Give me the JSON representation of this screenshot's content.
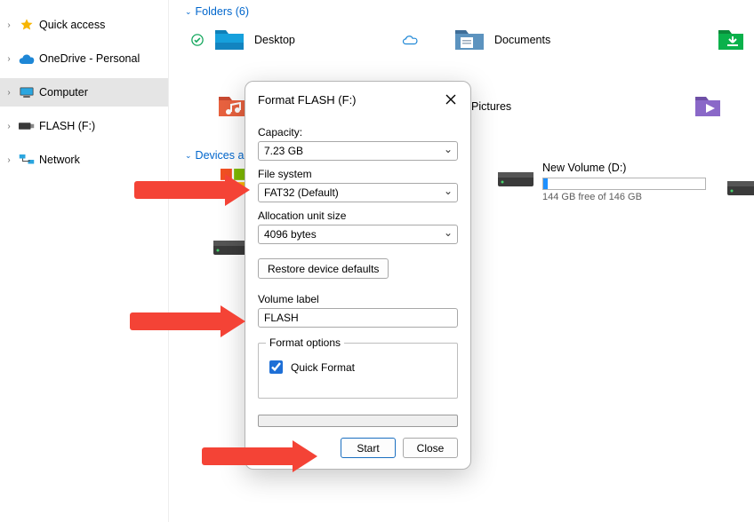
{
  "nav": {
    "items": [
      {
        "label": "Quick access"
      },
      {
        "label": "OneDrive - Personal"
      },
      {
        "label": "Computer"
      },
      {
        "label": "FLASH (F:)"
      },
      {
        "label": "Network"
      }
    ]
  },
  "groups": {
    "folders_header": "Folders (6)",
    "devices_header": "Devices a"
  },
  "folders": {
    "desktop": "Desktop",
    "documents": "Documents",
    "pictures": "Pictures"
  },
  "volume": {
    "label": "New Volume (D:)",
    "free_text": "144 GB free of 146 GB",
    "fill_pct": 3
  },
  "dialog": {
    "title": "Format FLASH (F:)",
    "capacity_label": "Capacity:",
    "capacity_value": "7.23 GB",
    "fs_label": "File system",
    "fs_value": "FAT32 (Default)",
    "alloc_label": "Allocation unit size",
    "alloc_value": "4096 bytes",
    "restore": "Restore device defaults",
    "volume_label_label": "Volume label",
    "volume_label_value": "FLASH",
    "format_options_legend": "Format options",
    "quick_format": "Quick Format",
    "start": "Start",
    "close": "Close"
  }
}
